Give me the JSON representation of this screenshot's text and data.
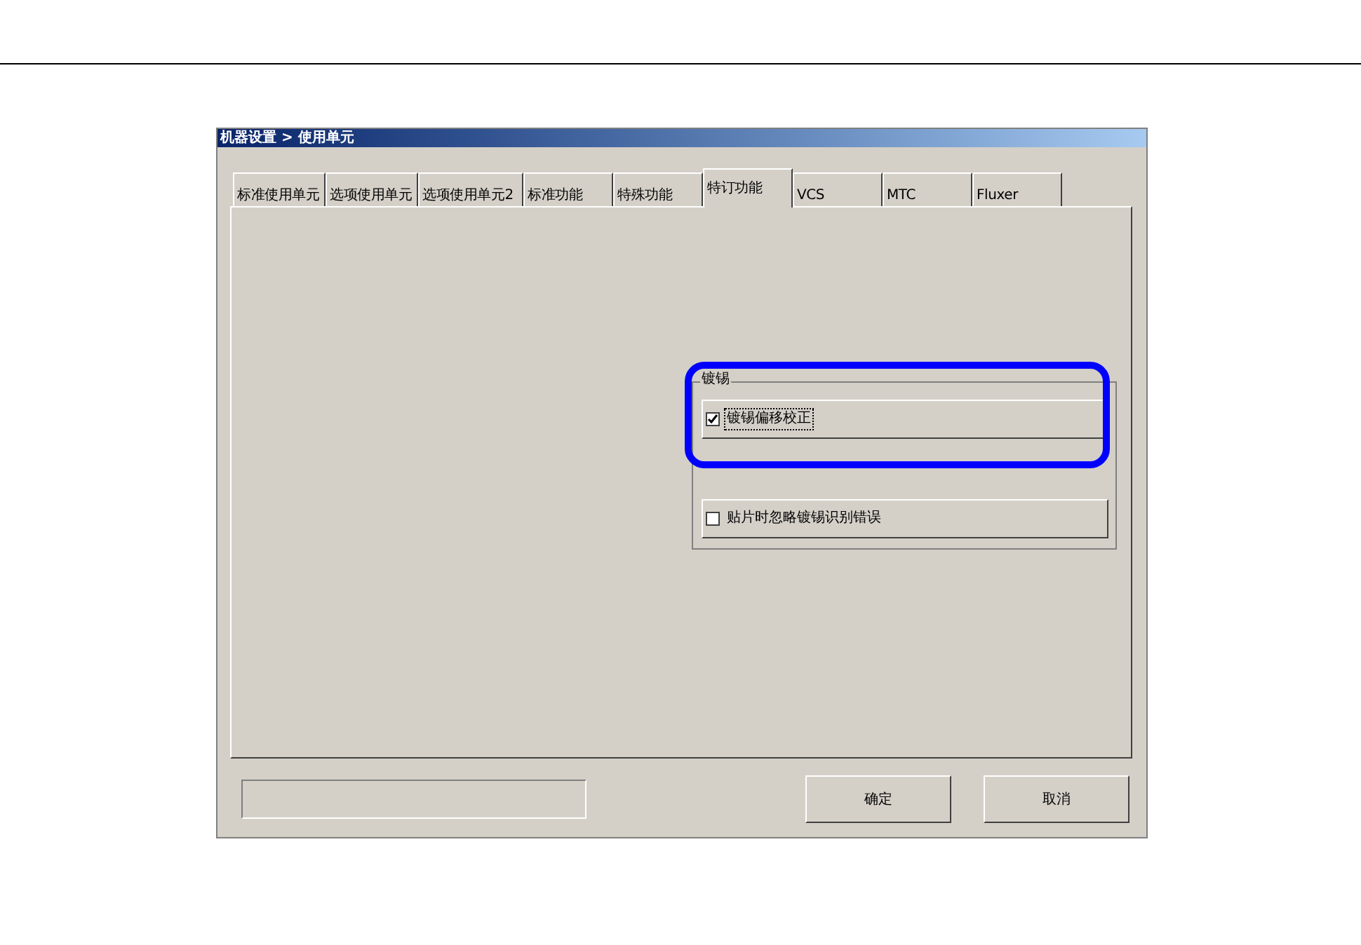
{
  "window": {
    "title": "机器设置 > 使用单元"
  },
  "tabs": [
    {
      "label": "标准使用单元",
      "selected": false
    },
    {
      "label": "选项使用单元",
      "selected": false
    },
    {
      "label": "选项使用单元2",
      "selected": false
    },
    {
      "label": "标准功能",
      "selected": false
    },
    {
      "label": "特殊功能",
      "selected": false
    },
    {
      "label": "特订功能",
      "selected": true
    },
    {
      "label": "VCS",
      "selected": false
    },
    {
      "label": "MTC",
      "selected": false
    },
    {
      "label": "Fluxer",
      "selected": false
    }
  ],
  "group": {
    "title": "镀锡",
    "options": [
      {
        "label": "镀锡偏移校正",
        "checked": true,
        "highlighted": true
      },
      {
        "label": "贴片时忽略镀锡识别错误",
        "checked": false,
        "highlighted": false
      }
    ]
  },
  "buttons": [
    "确定",
    "取消"
  ]
}
